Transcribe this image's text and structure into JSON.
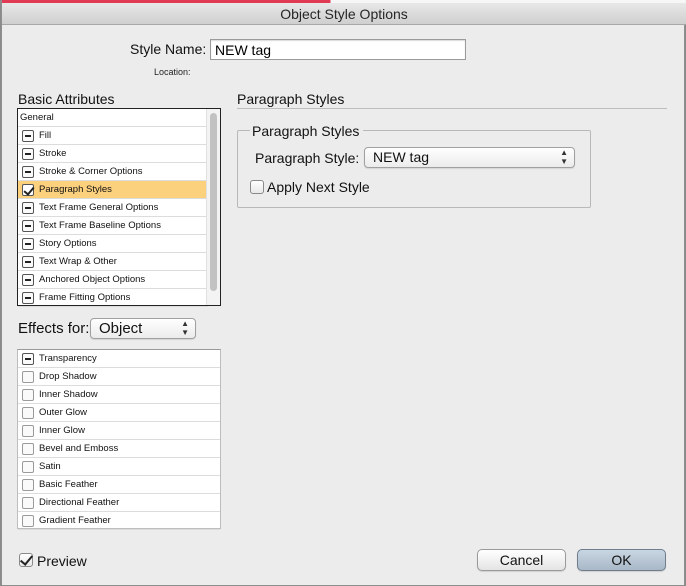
{
  "window": {
    "title": "Object Style Options"
  },
  "style_name": {
    "label": "Style Name:",
    "value": "NEW tag"
  },
  "location": {
    "label": "Location:"
  },
  "basic_attributes": {
    "title": "Basic Attributes",
    "items": [
      {
        "label": "General",
        "icon": "none"
      },
      {
        "label": "Fill",
        "icon": "minus"
      },
      {
        "label": "Stroke",
        "icon": "minus"
      },
      {
        "label": "Stroke & Corner Options",
        "icon": "minus"
      },
      {
        "label": "Paragraph Styles",
        "icon": "check",
        "selected": true
      },
      {
        "label": "Text Frame General Options",
        "icon": "minus"
      },
      {
        "label": "Text Frame Baseline Options",
        "icon": "minus"
      },
      {
        "label": "Story Options",
        "icon": "minus"
      },
      {
        "label": "Text Wrap & Other",
        "icon": "minus"
      },
      {
        "label": "Anchored Object Options",
        "icon": "minus"
      },
      {
        "label": "Frame Fitting Options",
        "icon": "minus"
      }
    ]
  },
  "effects": {
    "label": "Effects for:",
    "selected": "Object",
    "items": [
      {
        "label": "Transparency",
        "icon": "minus"
      },
      {
        "label": "Drop Shadow",
        "icon": "empty"
      },
      {
        "label": "Inner Shadow",
        "icon": "empty"
      },
      {
        "label": "Outer Glow",
        "icon": "empty"
      },
      {
        "label": "Inner Glow",
        "icon": "empty"
      },
      {
        "label": "Bevel and Emboss",
        "icon": "empty"
      },
      {
        "label": "Satin",
        "icon": "empty"
      },
      {
        "label": "Basic Feather",
        "icon": "empty"
      },
      {
        "label": "Directional Feather",
        "icon": "empty"
      },
      {
        "label": "Gradient Feather",
        "icon": "empty"
      }
    ]
  },
  "paragraph_styles": {
    "header": "Paragraph Styles",
    "group_title": "Paragraph Styles",
    "style_label": "Paragraph Style:",
    "style_value": "NEW tag",
    "apply_next_label": "Apply Next Style",
    "apply_next_checked": false
  },
  "footer": {
    "preview_label": "Preview",
    "preview_checked": true,
    "cancel_label": "Cancel",
    "ok_label": "OK"
  },
  "colors": {
    "selection": "#fcd17e",
    "window_bg": "#ececec",
    "ok_button": "#b5c3d1"
  }
}
